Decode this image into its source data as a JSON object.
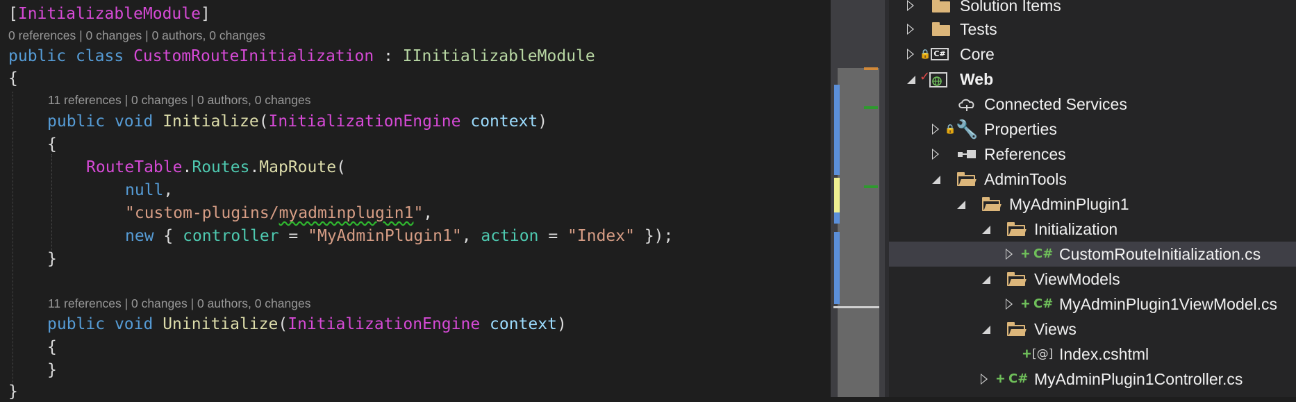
{
  "editor": {
    "attribute_line": {
      "open": "[",
      "name": "InitializableModule",
      "close": "]"
    },
    "lens_class": "0 references | 0 changes | 0 authors, 0 changes",
    "class_decl": {
      "kw1": "public",
      "kw2": "class",
      "name": "CustomRouteInitialization",
      "sep": " : ",
      "base": "IInitializableModule"
    },
    "brace_open": "{",
    "lens_initialize": "11 references | 0 changes | 0 authors, 0 changes",
    "init_decl": {
      "kw1": "public",
      "kw2": "void",
      "name": "Initialize",
      "paren_open": "(",
      "ptype": "InitializationEngine",
      "pname": "context",
      "paren_close": ")"
    },
    "init_brace_open": "{",
    "maproute": {
      "obj": "RouteTable",
      "dot1": ".",
      "prop": "Routes",
      "dot2": ".",
      "method": "MapRoute",
      "paren": "("
    },
    "arg_null": {
      "val": "null",
      "comma": ","
    },
    "arg_url": {
      "q1": "\"custom-plugins/",
      "squiggle": "myadminplugin1",
      "q2": "\"",
      "comma": ","
    },
    "arg_defaults": {
      "kw": "new",
      "open": " { ",
      "k1": "controller",
      "eq1": " = ",
      "v1": "\"MyAdminPlugin1\"",
      "comma": ", ",
      "k2": "action",
      "eq2": " = ",
      "v2": "\"Index\"",
      "close": " });"
    },
    "init_brace_close": "}",
    "lens_uninitialize": "11 references | 0 changes | 0 authors, 0 changes",
    "uninit_decl": {
      "kw1": "public",
      "kw2": "void",
      "name": "Uninitialize",
      "paren_open": "(",
      "ptype": "InitializationEngine",
      "pname": "context",
      "paren_close": ")"
    },
    "uninit_brace_open": "{",
    "uninit_brace_close": "}",
    "brace_close": "}"
  },
  "colors": {
    "editor_bg": "#1e1e1e",
    "explorer_bg": "#252526",
    "selected_row": "#3f3f46",
    "added_green": "#6fbf5a",
    "folder": "#dcb67a"
  },
  "explorer": {
    "items": [
      {
        "label": "Solution Items",
        "icon": "folder-icon",
        "expander": "collapsed"
      },
      {
        "label": "Tests",
        "icon": "folder-icon",
        "expander": "collapsed"
      },
      {
        "label": "Core",
        "icon": "csharp-project-icon",
        "expander": "collapsed",
        "badge": "lock"
      },
      {
        "label": "Web",
        "icon": "web-project-icon",
        "expander": "expanded",
        "badge": "checkmark"
      },
      {
        "label": "Connected Services",
        "icon": "cloud-services-icon",
        "expander": "none"
      },
      {
        "label": "Properties",
        "icon": "wrench-icon",
        "expander": "collapsed",
        "badge": "lock"
      },
      {
        "label": "References",
        "icon": "references-icon",
        "expander": "collapsed"
      },
      {
        "label": "AdminTools",
        "icon": "open-folder-icon",
        "expander": "expanded"
      },
      {
        "label": "MyAdminPlugin1",
        "icon": "open-folder-icon",
        "expander": "expanded"
      },
      {
        "label": "Initialization",
        "icon": "open-folder-icon",
        "expander": "expanded"
      },
      {
        "label": "CustomRouteInitialization.cs",
        "icon": "csharp-file-icon",
        "expander": "collapsed",
        "added": "+",
        "selected": true
      },
      {
        "label": "ViewModels",
        "icon": "open-folder-icon",
        "expander": "expanded"
      },
      {
        "label": "MyAdminPlugin1ViewModel.cs",
        "icon": "csharp-file-icon",
        "expander": "collapsed",
        "added": "+"
      },
      {
        "label": "Views",
        "icon": "open-folder-icon",
        "expander": "expanded"
      },
      {
        "label": "Index.cshtml",
        "icon": "razor-file-icon",
        "expander": "none",
        "added": "+"
      },
      {
        "label": "MyAdminPlugin1Controller.cs",
        "icon": "csharp-file-icon",
        "expander": "collapsed",
        "added": "+"
      }
    ],
    "cs_glyph": "C#",
    "razor_glyph": "[@]"
  }
}
